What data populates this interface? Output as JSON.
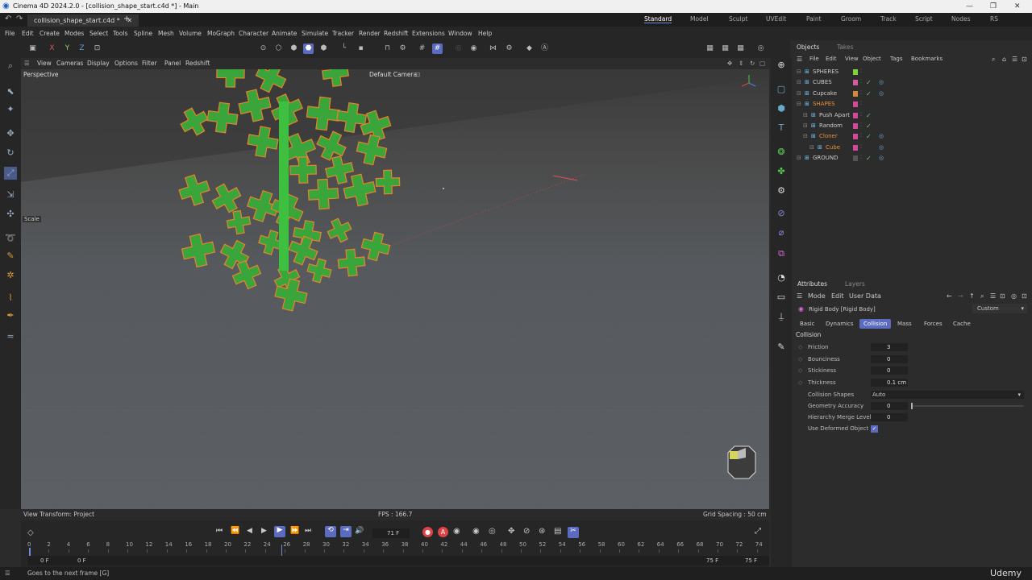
{
  "window": {
    "title": "Cinema 4D 2024.2.0 - [collision_shape_start.c4d *] - Main"
  },
  "tabs": {
    "doc": "collision_shape_start.c4d *",
    "add": "+"
  },
  "layouts": [
    "Standard",
    "Model",
    "Sculpt",
    "UVEdit",
    "Paint",
    "Groom",
    "Track",
    "Script",
    "Nodes",
    "RS"
  ],
  "menus": [
    "File",
    "Edit",
    "Create",
    "Modes",
    "Select",
    "Tools",
    "Spline",
    "Mesh",
    "Volume",
    "MoGraph",
    "Character",
    "Animate",
    "Simulate",
    "Tracker",
    "Render",
    "Redshift",
    "Extensions",
    "Window",
    "Help"
  ],
  "axis_toolbar": [
    "X",
    "Y",
    "Z"
  ],
  "viewport": {
    "menus": [
      "View",
      "Cameras",
      "Display",
      "Options",
      "Filter",
      "Panel",
      "Redshift"
    ],
    "label": "Perspective",
    "camera": "Default Camera",
    "tool_tag": "Scale",
    "status_left": "View Transform: Project",
    "fps": "FPS : 166.7",
    "grid": "Grid Spacing : 50 cm"
  },
  "timeline": {
    "frame": "71 F",
    "ticks": [
      "0",
      "2",
      "4",
      "6",
      "8",
      "10",
      "12",
      "14",
      "16",
      "18",
      "20",
      "22",
      "24",
      "26",
      "28",
      "30",
      "32",
      "34",
      "36",
      "38",
      "40",
      "42",
      "44",
      "46",
      "48",
      "50",
      "52",
      "54",
      "56",
      "58",
      "60",
      "62",
      "64",
      "66",
      "68",
      "70",
      "72",
      "74"
    ],
    "start": "0 F",
    "start2": "0 F",
    "end": "75 F",
    "end2": "75 F"
  },
  "objects": {
    "tabs": [
      "Objects",
      "Takes"
    ],
    "menus": [
      "File",
      "Edit",
      "View",
      "Object",
      "Tags",
      "Bookmarks"
    ],
    "items": [
      {
        "name": "SPHERES",
        "color": "#7fd33a"
      },
      {
        "name": "CUBES",
        "color": "#d35aa0"
      },
      {
        "name": "Cupcake",
        "color": "#d38a3a"
      },
      {
        "name": "SHAPES",
        "color": "#d34a9a"
      },
      {
        "name": "Push Apart",
        "color": "#d34a9a"
      },
      {
        "name": "Random",
        "color": "#d34a9a"
      },
      {
        "name": "Cloner",
        "color": "#d34a9a"
      },
      {
        "name": "Cube",
        "color": "#d34a9a"
      },
      {
        "name": "GROUND",
        "color": "#555555"
      }
    ]
  },
  "attributes": {
    "tabs": [
      "Attributes",
      "Layers"
    ],
    "menus": [
      "Mode",
      "Edit",
      "User Data"
    ],
    "object": "Rigid Body [Rigid Body]",
    "preset": "Custom",
    "subtabs": [
      "Basic",
      "Dynamics",
      "Collision",
      "Mass",
      "Forces",
      "Cache"
    ],
    "section": "Collision",
    "props": [
      {
        "label": "Friction",
        "value": "3"
      },
      {
        "label": "Bounciness",
        "value": "0"
      },
      {
        "label": "Stickiness",
        "value": "0"
      },
      {
        "label": "Thickness",
        "value": "0.1 cm"
      }
    ],
    "collision_shapes_label": "Collision Shapes",
    "collision_shapes_value": "Auto",
    "geometry_accuracy_label": "Geometry Accuracy",
    "geometry_accuracy_value": "0",
    "hierarchy_label": "Hierarchy Merge Level",
    "hierarchy_value": "0",
    "deformed_label": "Use Deformed Object"
  },
  "statusbar": "Goes to the next frame [G]",
  "watermark": "Udemy",
  "colors": {
    "accent": "#5b6bbf",
    "clone_green": "#3aa53a",
    "clone_outline": "#e8832a"
  }
}
